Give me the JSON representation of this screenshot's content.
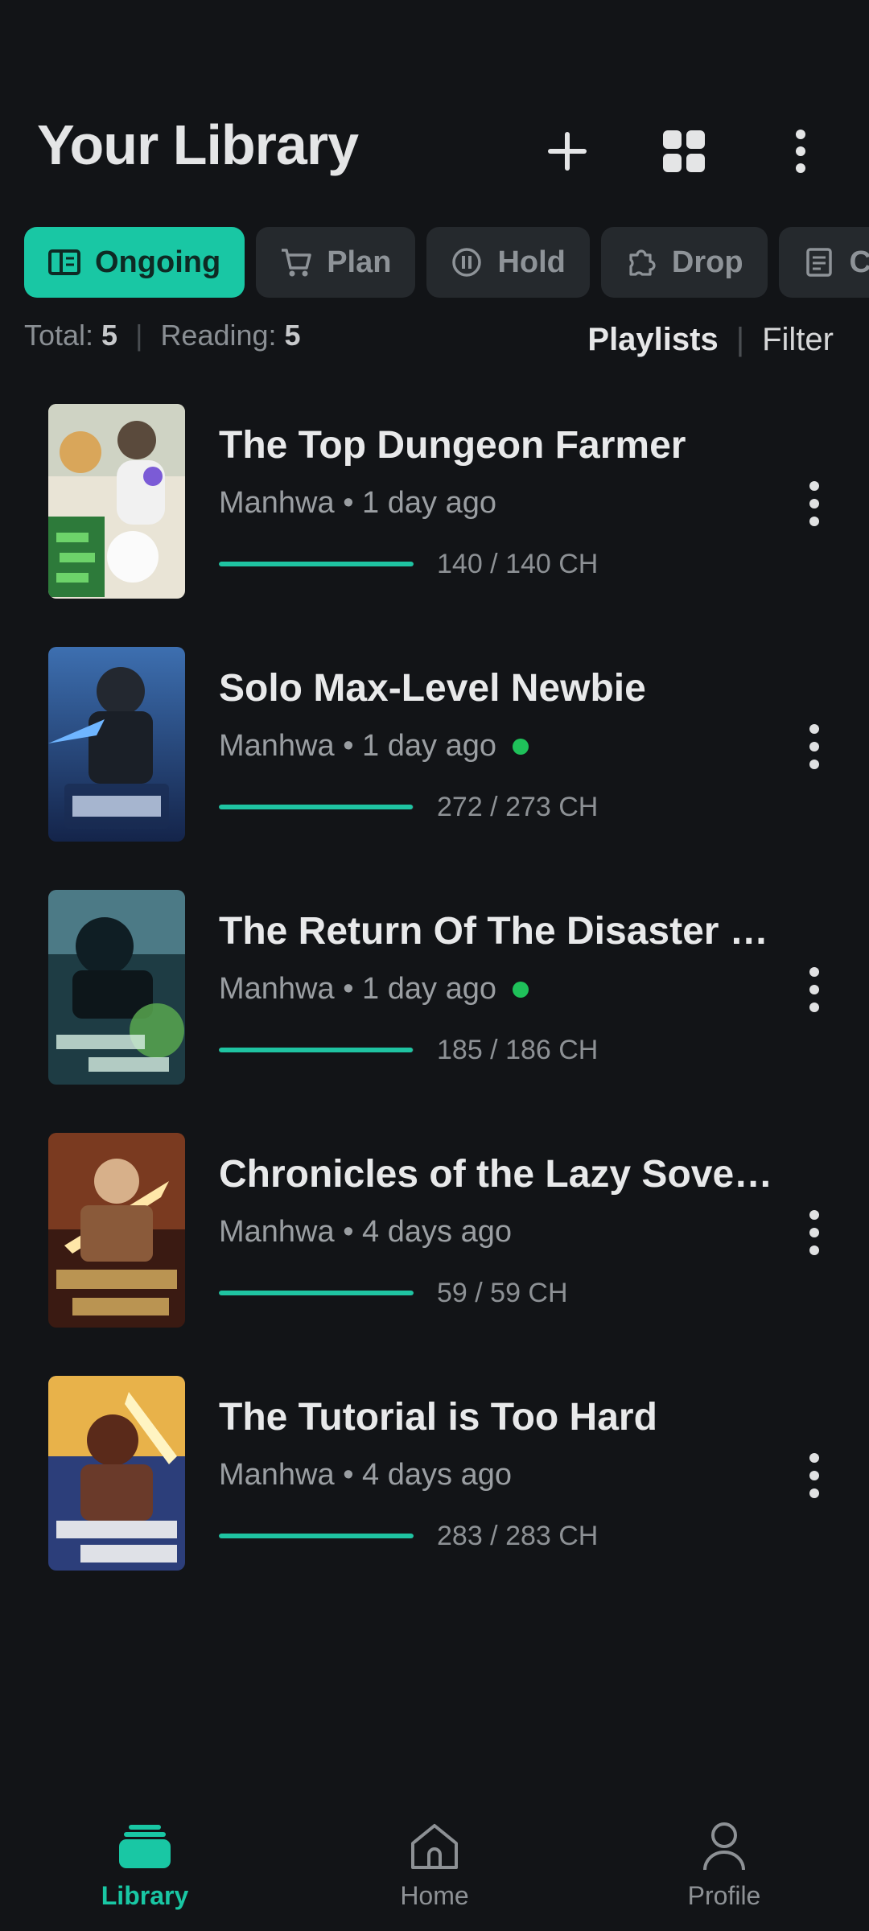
{
  "header": {
    "title": "Your Library"
  },
  "chips": [
    {
      "label": "Ongoing",
      "icon": "book-open-icon",
      "active": true
    },
    {
      "label": "Plan",
      "icon": "cart-icon",
      "active": false
    },
    {
      "label": "Hold",
      "icon": "pause-circle-icon",
      "active": false
    },
    {
      "label": "Drop",
      "icon": "puzzle-icon",
      "active": false
    },
    {
      "label": "C",
      "icon": "document-icon",
      "active": false
    }
  ],
  "stats": {
    "total_label": "Total: ",
    "total_value": "5",
    "sep": "|",
    "reading_label": "Reading: ",
    "reading_value": "5"
  },
  "links": {
    "playlists": "Playlists",
    "sep": "|",
    "filter": "Filter"
  },
  "items": [
    {
      "title": "The Top Dungeon Farmer",
      "meta": "Manhwa • 1 day ago",
      "new": false,
      "chapters": "140 / 140 CH",
      "progress": 1.0
    },
    {
      "title": "Solo Max-Level Newbie",
      "meta": "Manhwa • 1 day ago",
      "new": true,
      "chapters": "272 / 273 CH",
      "progress": 0.996
    },
    {
      "title": "The Return Of The Disaster C...",
      "meta": "Manhwa • 1 day ago",
      "new": true,
      "chapters": "185 / 186 CH",
      "progress": 0.995
    },
    {
      "title": "Chronicles of the Lazy Sovere...",
      "meta": "Manhwa • 4 days ago",
      "new": false,
      "chapters": "59 / 59 CH",
      "progress": 1.0
    },
    {
      "title": "The Tutorial is Too Hard",
      "meta": "Manhwa • 4 days ago",
      "new": false,
      "chapters": "283 / 283 CH",
      "progress": 1.0
    }
  ],
  "nav": [
    {
      "label": "Library",
      "icon": "library-stack-icon",
      "active": true
    },
    {
      "label": "Home",
      "icon": "home-icon",
      "active": false
    },
    {
      "label": "Profile",
      "icon": "person-icon",
      "active": false
    }
  ],
  "colors": {
    "accent": "#19c7a4",
    "background": "#121417",
    "chip": "#25292d",
    "new_dot": "#1fc15a"
  }
}
